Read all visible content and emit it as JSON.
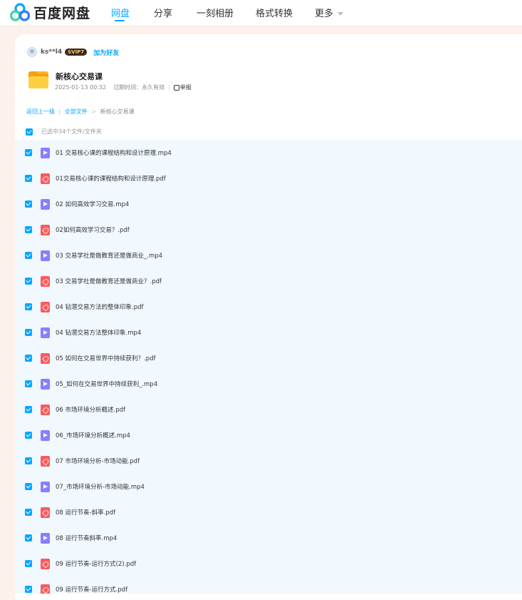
{
  "nav": {
    "logo_text": "百度网盘",
    "items": [
      {
        "label": "网盘",
        "active": true
      },
      {
        "label": "分享",
        "active": false
      },
      {
        "label": "一刻相册",
        "active": false
      },
      {
        "label": "格式转换",
        "active": false
      },
      {
        "label": "更多",
        "active": false
      }
    ]
  },
  "share": {
    "username": "ks**l4",
    "badge": "SVIP7",
    "add_friend": "加为好友",
    "title": "新核心交易课",
    "date": "2025-01-13 00:32",
    "expiry": "过期时间：永久有效",
    "report": "举报"
  },
  "breadcrumb": {
    "back": "返回上一级",
    "divider": "|",
    "all_files": "全部文件",
    "arrow": ">",
    "current": "新核心交易课"
  },
  "selection": {
    "text": "已选中34个文件/文件夹"
  },
  "files": [
    {
      "name": "01 交易核心课的课程结构和设计原理.mp4",
      "type": "mp4"
    },
    {
      "name": "01交易核心课的课程结构和设计原理.pdf",
      "type": "pdf"
    },
    {
      "name": "02 如何高效学习交易.mp4",
      "type": "mp4"
    },
    {
      "name": "02如何高效学习交易？.pdf",
      "type": "pdf"
    },
    {
      "name": "03 交易学社是做教育还是做商业_.mp4",
      "type": "mp4"
    },
    {
      "name": "03 交易学社是做教育还是做商业？.pdf",
      "type": "pdf"
    },
    {
      "name": "04 钻潜交易方法的整体印象.pdf",
      "type": "pdf"
    },
    {
      "name": "04 钻潜交易方法整体印象.mp4",
      "type": "mp4"
    },
    {
      "name": "05 如何在交易世界中持续获利？.pdf",
      "type": "pdf"
    },
    {
      "name": "05_如何在交易世界中持续获利_.mp4",
      "type": "mp4"
    },
    {
      "name": "06 市场环境分析概述.pdf",
      "type": "pdf"
    },
    {
      "name": "06_市场环境分析概述.mp4",
      "type": "mp4"
    },
    {
      "name": "07 市场环境分析-市场动能.pdf",
      "type": "pdf"
    },
    {
      "name": "07_市场环境分析-市场动能.mp4",
      "type": "mp4"
    },
    {
      "name": "08 运行节奏-斜率.pdf",
      "type": "pdf"
    },
    {
      "name": "08 运行节奏斜率.mp4",
      "type": "mp4"
    },
    {
      "name": "09 运行节奏-运行方式(2).pdf",
      "type": "pdf"
    },
    {
      "name": "09 运行节奏-运行方式.pdf",
      "type": "pdf"
    }
  ],
  "colors": {
    "accent": "#06a7ff",
    "mp4_icon": "#8a7dff",
    "pdf_icon": "#fb5b5b",
    "list_bg": "#f1f8fe",
    "page_bg": "#fdf1ec"
  }
}
